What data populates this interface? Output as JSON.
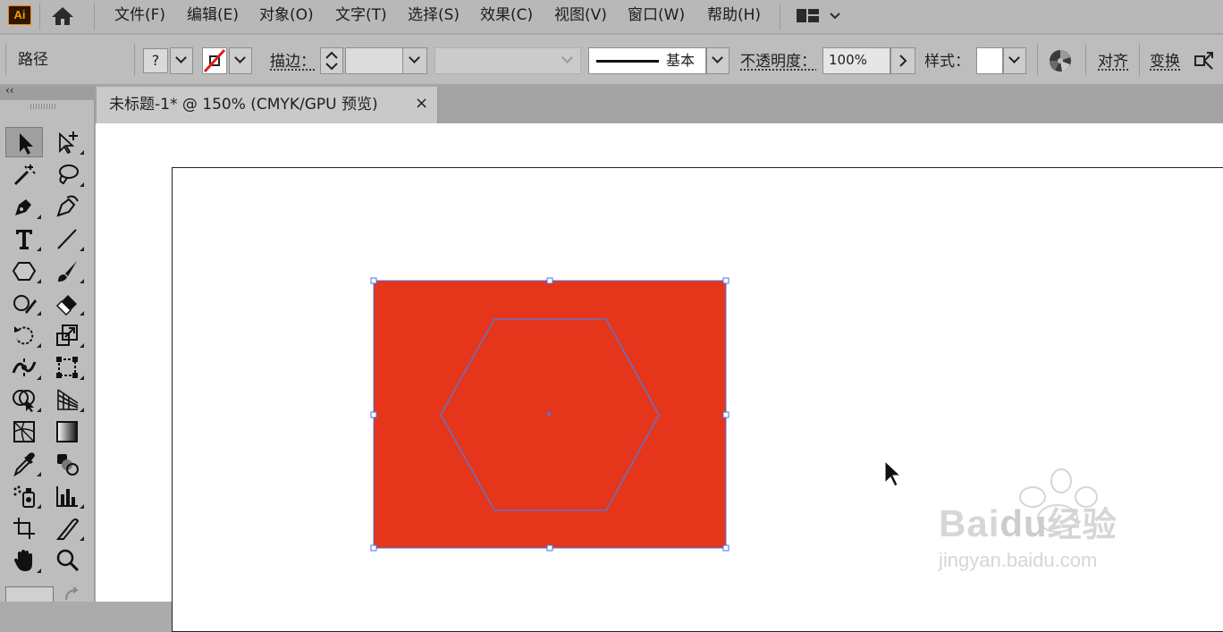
{
  "app": {
    "logo": "Ai"
  },
  "menu": [
    "文件(F)",
    "编辑(E)",
    "对象(O)",
    "文字(T)",
    "选择(S)",
    "效果(C)",
    "视图(V)",
    "窗口(W)",
    "帮助(H)"
  ],
  "control_bar": {
    "selection_type": "路径",
    "fill_value": "?",
    "stroke_label": "描边：",
    "stroke_profile": "基本",
    "opacity_label": "不透明度：",
    "opacity_value": "100%",
    "style_label": "样式：",
    "align_link": "对齐",
    "transform_link": "变换"
  },
  "document_tab": {
    "title": "未标题-1* @ 150% (CMYK/GPU 预览)",
    "close": "×"
  },
  "panel": {
    "collapse": "‹‹"
  },
  "tools": [
    "selection-tool",
    "direct-selection-tool",
    "magic-wand-tool",
    "lasso-tool",
    "pen-tool",
    "curvature-tool",
    "type-tool",
    "line-segment-tool",
    "polygon-tool",
    "paintbrush-tool",
    "shaper-tool",
    "eraser-tool",
    "rotate-tool",
    "scale-tool",
    "width-tool",
    "free-transform-tool",
    "shape-builder-tool",
    "perspective-grid-tool",
    "mesh-tool",
    "gradient-tool",
    "eyedropper-tool",
    "blend-tool",
    "symbol-sprayer-tool",
    "column-graph-tool",
    "artboard-tool",
    "slice-tool",
    "hand-tool",
    "zoom-tool"
  ],
  "artwork": {
    "rectangle_fill": "#e5361b",
    "hexagon_stroke": "#6b6fbf",
    "selection_color": "#4f6fe0"
  },
  "watermark": {
    "brand_a": "Bai",
    "brand_b": "du",
    "brand_c": "经验",
    "url": "jingyan.baidu.com"
  }
}
